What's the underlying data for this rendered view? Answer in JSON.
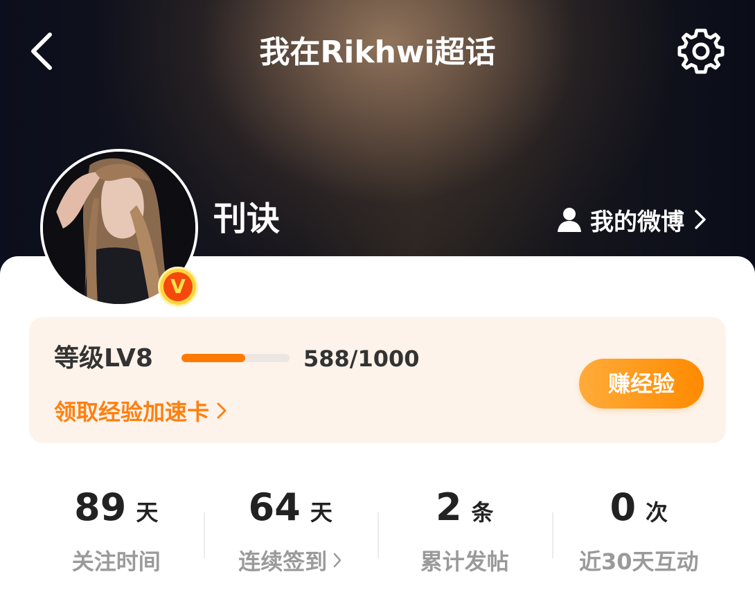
{
  "header": {
    "title": "我在Rikhwi超话",
    "back_icon": "chevron-left-icon",
    "settings_icon": "gear-icon"
  },
  "profile": {
    "username": "刊诀",
    "badge_text": "V",
    "my_weibo_label": "我的微博"
  },
  "level": {
    "label": "等级LV8",
    "progress_text": "588/1000",
    "progress_fraction": 0.588,
    "speed_card_link": "领取经验加速卡",
    "earn_button": "赚经验",
    "accent_color": "#ff7f0f"
  },
  "stats": [
    {
      "value": "89",
      "unit": "天",
      "label": "关注时间"
    },
    {
      "value": "64",
      "unit": "天",
      "label": "连续签到"
    },
    {
      "value": "2",
      "unit": "条",
      "label": "累计发帖"
    },
    {
      "value": "0",
      "unit": "次",
      "label": "近30天互动"
    }
  ]
}
